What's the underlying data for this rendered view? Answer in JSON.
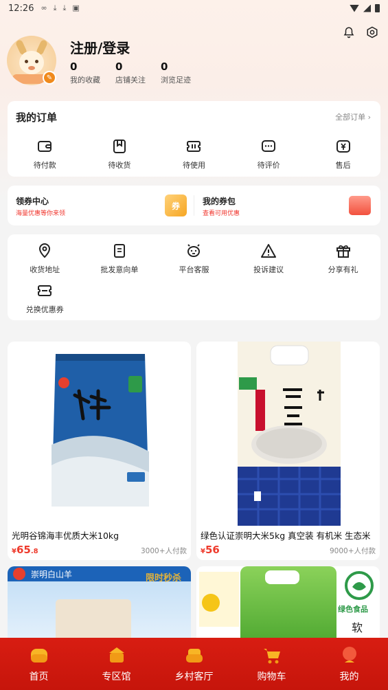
{
  "status_bar": {
    "time": "12:26"
  },
  "profile": {
    "login_label": "注册/登录",
    "stats": [
      {
        "count": "0",
        "label": "我的收藏"
      },
      {
        "count": "0",
        "label": "店铺关注"
      },
      {
        "count": "0",
        "label": "浏览足迹"
      }
    ]
  },
  "orders": {
    "title": "我的订单",
    "all_label": "全部订单 ›",
    "items": [
      {
        "label": "待付款",
        "icon": "wallet-icon"
      },
      {
        "label": "待收货",
        "icon": "package-icon"
      },
      {
        "label": "待使用",
        "icon": "ticket-icon"
      },
      {
        "label": "待评价",
        "icon": "comment-icon"
      },
      {
        "label": "售后",
        "icon": "refund-icon"
      }
    ]
  },
  "coupons": {
    "center_title": "领券中心",
    "center_sub": "海量优惠等你来领",
    "center_badge": "券",
    "wallet_title": "我的券包",
    "wallet_sub": "查看可用优惠"
  },
  "services": [
    {
      "label": "收货地址",
      "icon": "location-icon"
    },
    {
      "label": "批发意向单",
      "icon": "document-icon"
    },
    {
      "label": "平台客服",
      "icon": "customer-service-icon"
    },
    {
      "label": "投诉建议",
      "icon": "warning-icon"
    },
    {
      "label": "分享有礼",
      "icon": "gift-icon"
    },
    {
      "label": "兑换优惠券",
      "icon": "coupon-icon"
    }
  ],
  "products": [
    {
      "name": "光明谷锦海丰优质大米10kg",
      "price_symbol": "¥",
      "price_int": "65",
      "price_dec": ".8",
      "sales": "3000+人付款"
    },
    {
      "name": "绿色认证崇明大米5kg 真空装 有机米 生态米",
      "price_symbol": "¥",
      "price_int": "56",
      "price_dec": "",
      "sales": "9000+人付款"
    },
    {
      "banner_text": "崇明白山羊",
      "tag": "限时秒杀"
    },
    {
      "banner_text": "绿色食品",
      "side_text": "软"
    }
  ],
  "tabbar": [
    {
      "label": "首页",
      "icon": "home-icon"
    },
    {
      "label": "专区馆",
      "icon": "store-icon"
    },
    {
      "label": "乡村客厅",
      "icon": "sofa-icon"
    },
    {
      "label": "购物车",
      "icon": "cart-icon"
    },
    {
      "label": "我的",
      "icon": "profile-icon"
    }
  ],
  "colors": {
    "accent": "#ee3a2c",
    "tabbar": "#d81d12",
    "coupon_badge": "#f6a623"
  }
}
